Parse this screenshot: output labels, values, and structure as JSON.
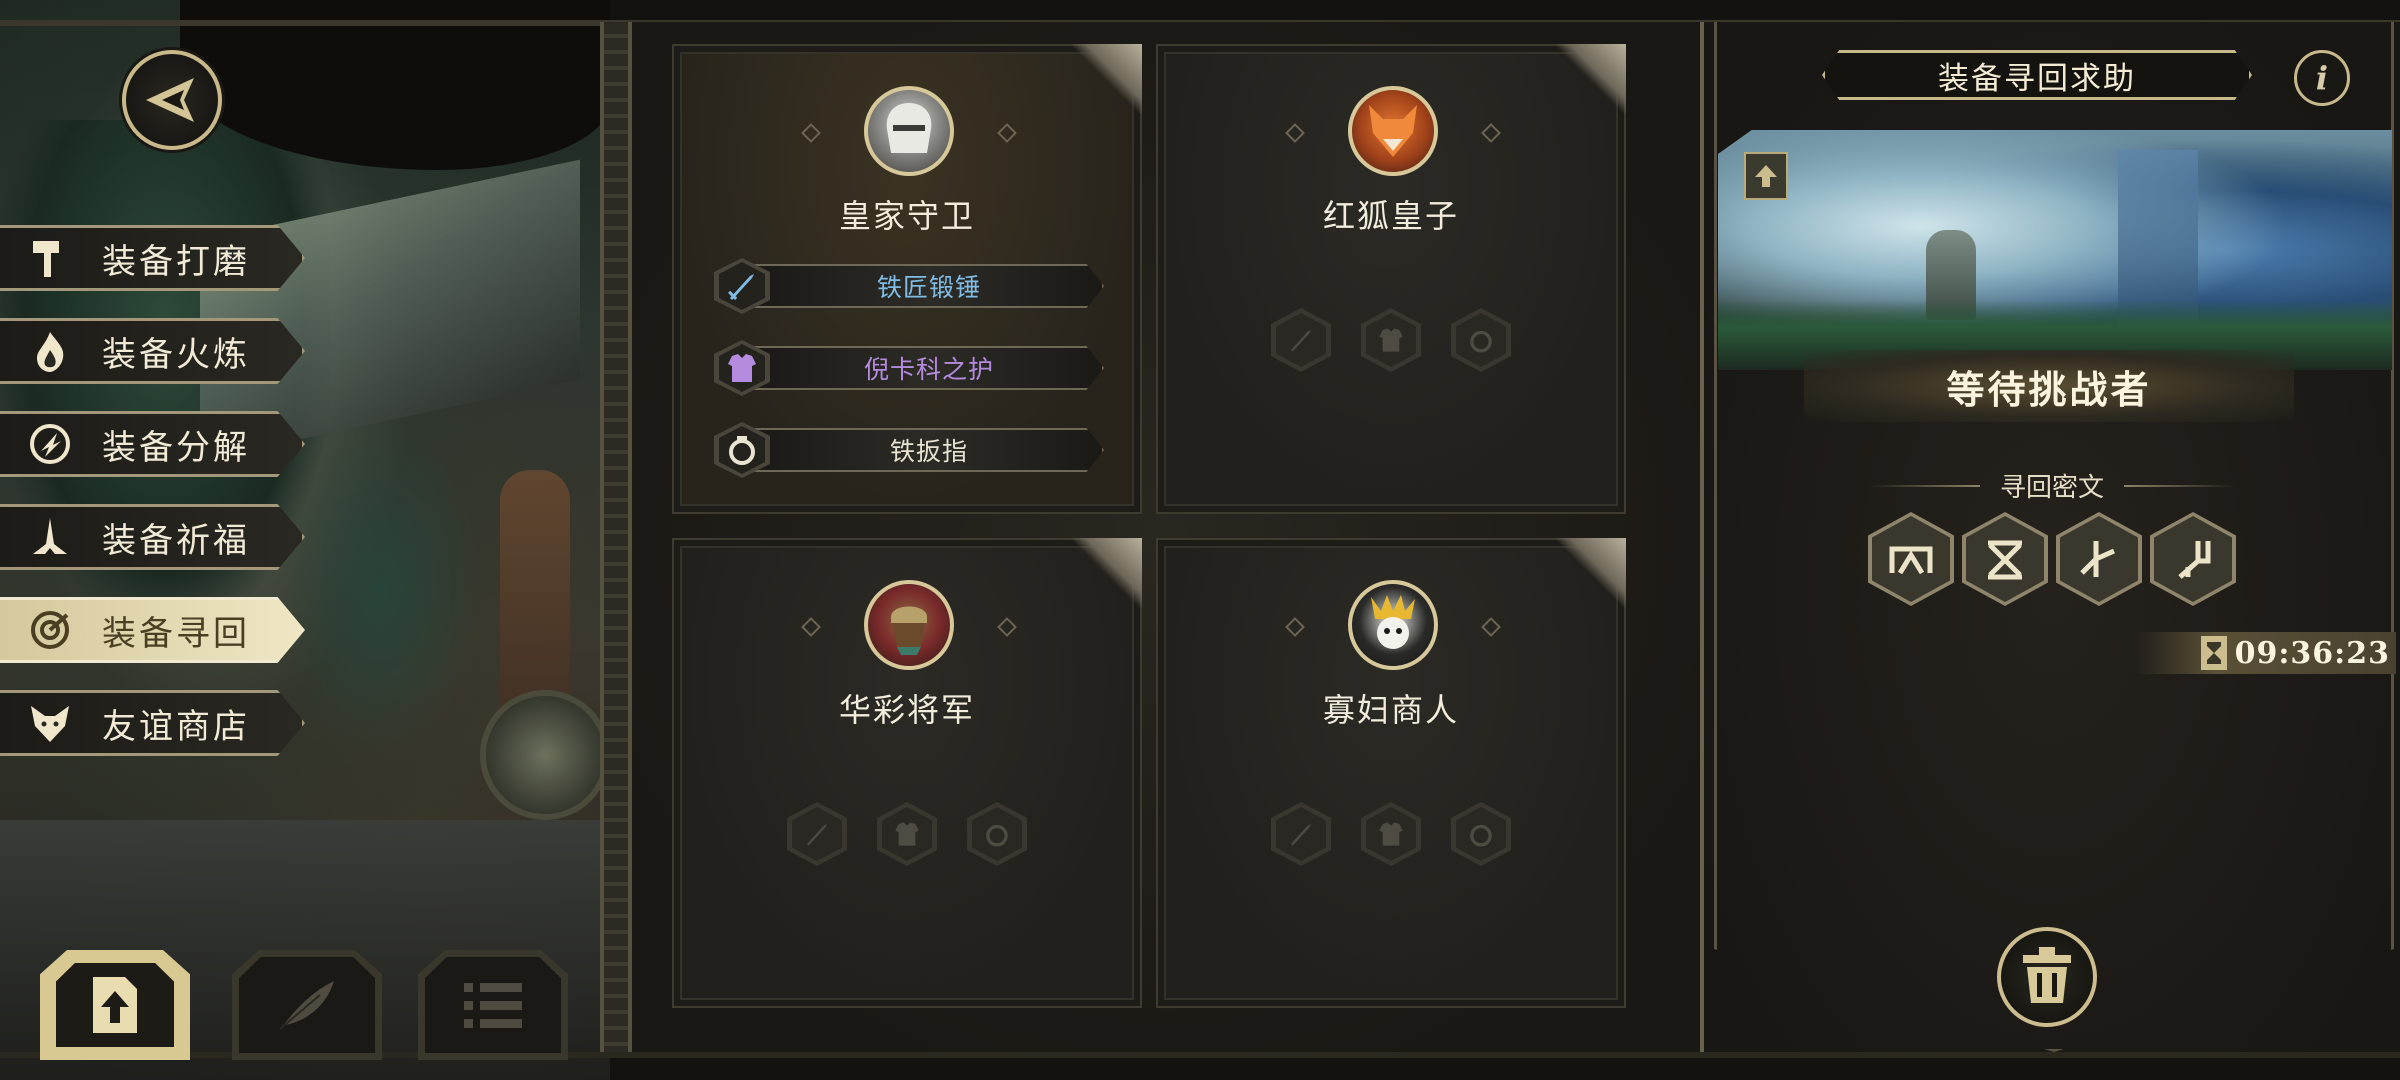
{
  "menu": [
    {
      "label": "装备打磨",
      "icon": "hammer-icon",
      "active": false
    },
    {
      "label": "装备火炼",
      "icon": "flame-icon",
      "active": false
    },
    {
      "label": "装备分解",
      "icon": "decompose-icon",
      "active": false
    },
    {
      "label": "装备祈福",
      "icon": "pray-hands-icon",
      "active": false
    },
    {
      "label": "装备寻回",
      "icon": "target-icon",
      "active": true
    },
    {
      "label": "友谊商店",
      "icon": "fox-head-icon",
      "active": false
    }
  ],
  "bottom_buttons": [
    "upload-icon",
    "feather-icon",
    "list-icon"
  ],
  "cards": [
    {
      "name": "皇家守卫",
      "portrait": "royal-guard-portrait",
      "equipment": [
        {
          "name": "铁匠锻锤",
          "icon": "sword-icon",
          "color": "#7fbde6"
        },
        {
          "name": "倪卡科之护",
          "icon": "armor-icon",
          "color": "#b58be0"
        },
        {
          "name": "铁扳指",
          "icon": "ring-icon",
          "color": "#e9e3d2"
        }
      ]
    },
    {
      "name": "红狐皇子",
      "portrait": "red-fox-prince-portrait",
      "empty_slots": [
        "sword-icon",
        "armor-icon",
        "ring-icon"
      ]
    },
    {
      "name": "华彩将军",
      "portrait": "general-portrait",
      "empty_slots": [
        "sword-icon",
        "armor-icon",
        "ring-icon"
      ]
    },
    {
      "name": "寡妇商人",
      "portrait": "widow-merchant-portrait",
      "empty_slots": [
        "sword-icon",
        "armor-icon",
        "ring-icon"
      ]
    }
  ],
  "right_panel": {
    "title": "装备寻回求助",
    "info": "i",
    "status": "等待挑战者",
    "section_label": "寻回密文",
    "runes": [
      "rune-1-icon",
      "rune-2-icon",
      "rune-3-icon",
      "rune-4-icon"
    ],
    "timer": "09:36:23"
  },
  "colors": {
    "gold": "#c9b98a",
    "active_menu": "#e3d8ae",
    "weapon_text": "#7fbde6",
    "armor_text": "#b58be0"
  }
}
